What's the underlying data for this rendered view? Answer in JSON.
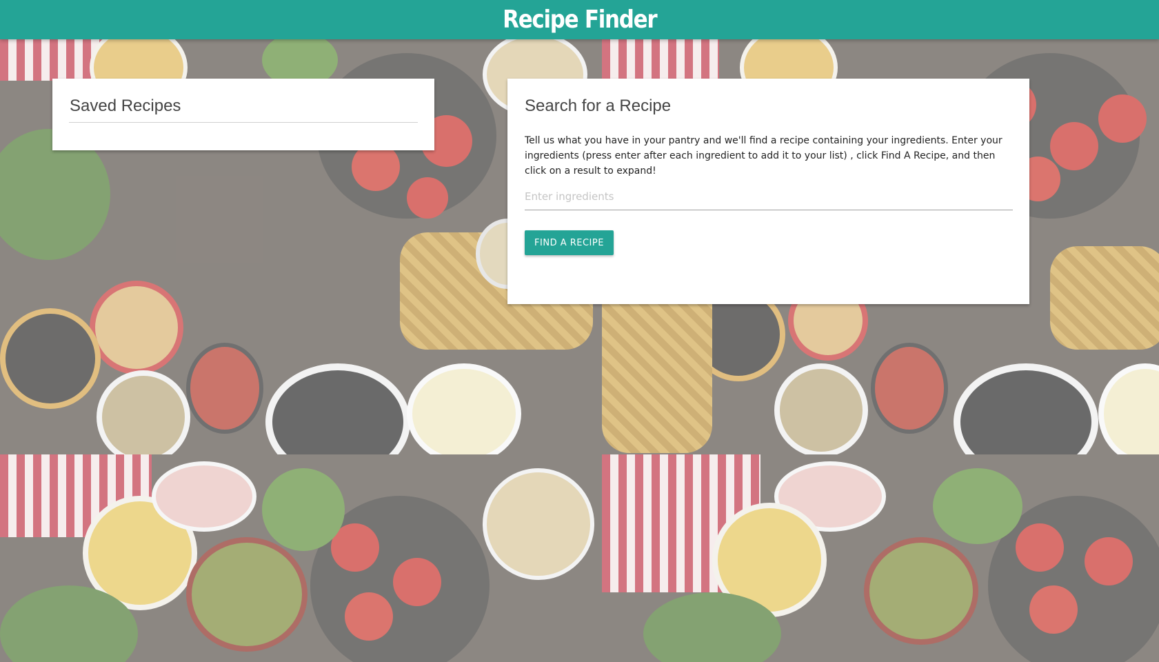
{
  "app": {
    "title": "Recipe Finder"
  },
  "colors": {
    "accent": "#24a496",
    "card": "#ffffff"
  },
  "saved_recipes": {
    "title": "Saved Recipes"
  },
  "search": {
    "title": "Search for a Recipe",
    "description": "Tell us what you have in your pantry and we'll find a recipe containing your ingredients. Enter your ingredients (press enter after each ingredient to add it to your list) , click Find A Recipe, and then click on a result to expand!",
    "ingredients_placeholder": "Enter ingredients",
    "ingredients_value": "",
    "button_label": "Find A Recipe"
  },
  "background": {
    "image": "food-ingredients-photo",
    "tiling": "repeated"
  }
}
